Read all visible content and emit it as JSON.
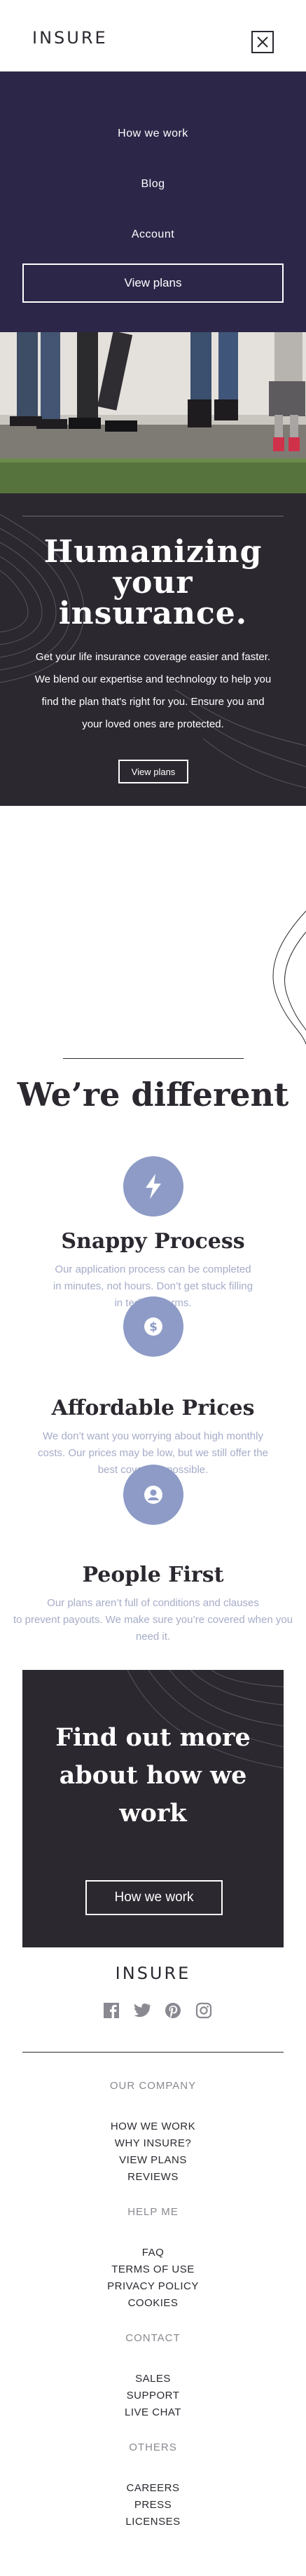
{
  "header": {
    "logo": "INSURE"
  },
  "nav": {
    "items": [
      {
        "label": "How we work"
      },
      {
        "label": "Blog"
      },
      {
        "label": "Account"
      }
    ],
    "cta": "View plans"
  },
  "hero": {
    "title_lines": [
      "Humanizing",
      "your",
      "insurance."
    ],
    "text_lines": [
      "Get your life insurance coverage easier and faster.",
      "We blend our expertise and technology to help you",
      "find the plan that's right for you. Ensure you and",
      "your loved ones are protected."
    ],
    "button": "View plans"
  },
  "different": {
    "title": "We’re different",
    "features": [
      {
        "icon": "lightning-icon",
        "title": "Snappy Process",
        "text_lines": [
          "Our application process can be completed",
          "in minutes, not hours. Don’t get stuck filling",
          "in tedious forms."
        ]
      },
      {
        "icon": "dollar-icon",
        "title": "Affordable Prices",
        "text_lines": [
          "We don’t want you worrying about high monthly",
          "costs. Our prices may be low, but we still offer the",
          "best coverage possible."
        ]
      },
      {
        "icon": "person-icon",
        "title": "People First",
        "text_lines": [
          "Our plans aren’t full of conditions and clauses",
          "to prevent payouts. We make sure you’re covered when you",
          "need it."
        ]
      }
    ]
  },
  "more": {
    "title_lines": [
      "Find out more",
      "about how we",
      "work"
    ],
    "button": "How we work"
  },
  "footer": {
    "logo": "INSURE",
    "socials": [
      "facebook-icon",
      "twitter-icon",
      "pinterest-icon",
      "instagram-icon"
    ],
    "groups": [
      {
        "heading": "OUR COMPANY",
        "links": [
          "HOW WE WORK",
          "WHY INSURE?",
          "VIEW PLANS",
          "REVIEWS"
        ]
      },
      {
        "heading": "HELP ME",
        "links": [
          "FAQ",
          "TERMS OF USE",
          "PRIVACY POLICY",
          "COOKIES"
        ]
      },
      {
        "heading": "CONTACT",
        "links": [
          "SALES",
          "SUPPORT",
          "LIVE CHAT"
        ]
      },
      {
        "heading": "OTHERS",
        "links": [
          "CAREERS",
          "PRESS",
          "LICENSES"
        ]
      }
    ]
  },
  "colors": {
    "nav_bg": "#2c2749",
    "dark_bg": "#2c2830",
    "accent_icon": "#8d9bc6",
    "muted_text": "#a6acc8"
  }
}
